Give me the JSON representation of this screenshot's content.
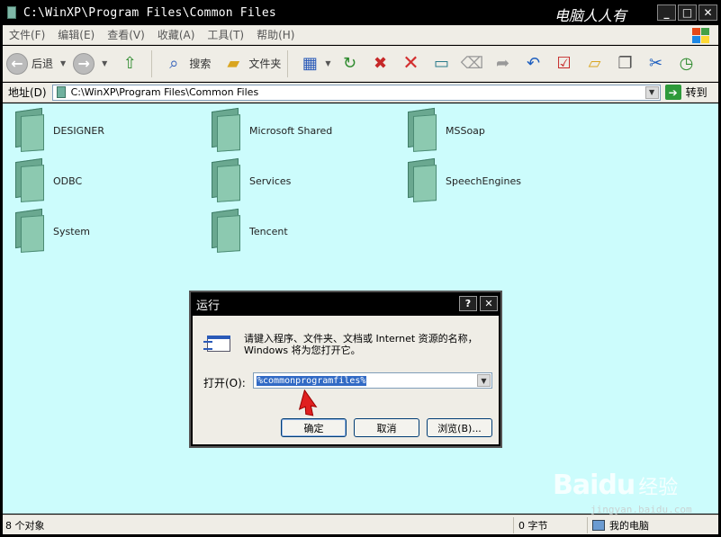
{
  "window": {
    "title": "C:\\WinXP\\Program Files\\Common Files",
    "overlay_title": "电脑人人有"
  },
  "menubar": {
    "items": [
      "文件(F)",
      "编辑(E)",
      "查看(V)",
      "收藏(A)",
      "工具(T)",
      "帮助(H)"
    ]
  },
  "toolbar": {
    "back_label": "后退",
    "search_label": "搜索",
    "folders_label": "文件夹"
  },
  "addressbar": {
    "label": "地址(D)",
    "value": "C:\\WinXP\\Program Files\\Common Files",
    "go_label": "转到"
  },
  "folders": [
    {
      "name": "DESIGNER"
    },
    {
      "name": "Microsoft Shared"
    },
    {
      "name": "MSSoap"
    },
    {
      "name": "ODBC"
    },
    {
      "name": "Services"
    },
    {
      "name": "SpeechEngines"
    },
    {
      "name": "System"
    },
    {
      "name": "Tencent"
    }
  ],
  "run_dialog": {
    "title": "运行",
    "prompt": "请键入程序、文件夹、文档或 Internet 资源的名称，Windows 将为您打开它。",
    "open_label": "打开(O):",
    "open_value": "%commonprogramfiles%",
    "ok_label": "确定",
    "cancel_label": "取消",
    "browse_label": "浏览(B)..."
  },
  "statusbar": {
    "objects": "8 个对象",
    "size": "0 字节",
    "location": "我的电脑"
  },
  "watermark": {
    "brand": "Baidu",
    "sub": "经验",
    "url": "jingyan.baidu.com"
  },
  "colors": {
    "content_bg": "#ccfcfc",
    "chrome_bg": "#efede6",
    "title_bg": "#000000",
    "selection": "#316ac5"
  }
}
